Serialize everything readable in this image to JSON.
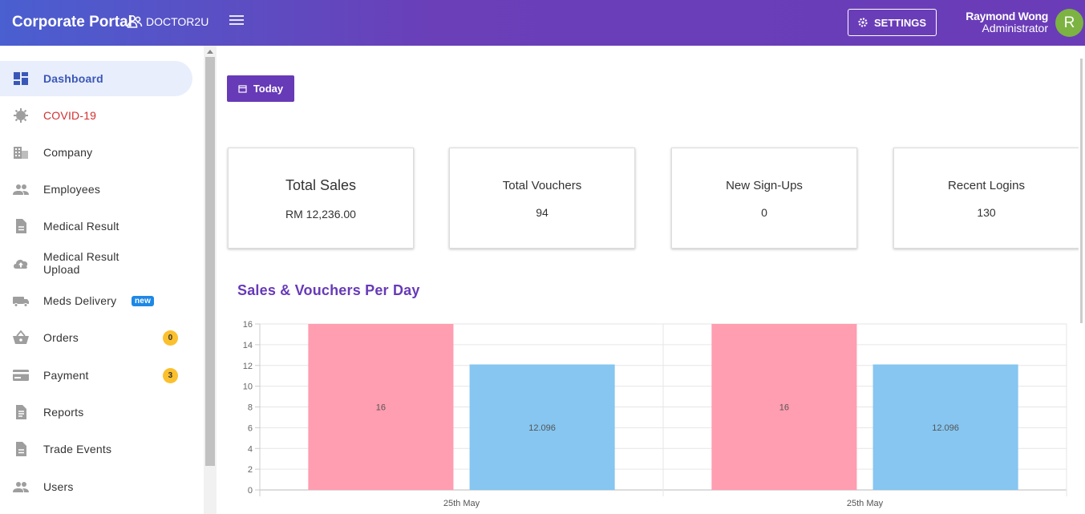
{
  "header": {
    "brand": "Corporate Portal",
    "org": "DOCTOR2U",
    "settings_label": "SETTINGS",
    "user_name": "Raymond Wong",
    "user_role": "Administrator",
    "avatar_initial": "R"
  },
  "sidebar": {
    "items": [
      {
        "label": "Dashboard",
        "icon": "dashboard-icon"
      },
      {
        "label": "COVID-19",
        "icon": "virus-icon"
      },
      {
        "label": "Company",
        "icon": "building-icon"
      },
      {
        "label": "Employees",
        "icon": "people-icon"
      },
      {
        "label": "Medical Result",
        "icon": "document-icon"
      },
      {
        "label": "Medical Result Upload",
        "icon": "cloud-upload-icon"
      },
      {
        "label": "Meds Delivery",
        "icon": "truck-icon",
        "tag": "new"
      },
      {
        "label": "Orders",
        "icon": "basket-icon",
        "badge": "0"
      },
      {
        "label": "Payment",
        "icon": "credit-card-icon",
        "badge": "3"
      },
      {
        "label": "Reports",
        "icon": "report-icon"
      },
      {
        "label": "Trade Events",
        "icon": "document-icon"
      },
      {
        "label": "Users",
        "icon": "people-icon"
      }
    ]
  },
  "main": {
    "today_label": "Today",
    "cards": [
      {
        "title": "Total Sales",
        "value": "RM 12,236.00"
      },
      {
        "title": "Total Vouchers",
        "value": "94"
      },
      {
        "title": "New Sign-Ups",
        "value": "0"
      },
      {
        "title": "Recent Logins",
        "value": "130"
      }
    ],
    "chart_title": "Sales & Vouchers Per Day"
  },
  "colors": {
    "accent": "#673ab7",
    "sales_bar": "#ff9db1",
    "vouchers_bar": "#86c6f0"
  },
  "chart_data": {
    "type": "bar",
    "categories": [
      "25th May",
      "25th May"
    ],
    "series": [
      {
        "values": [
          16,
          16
        ],
        "labels": [
          "16",
          "16"
        ]
      },
      {
        "values": [
          12.096,
          12.096
        ],
        "labels": [
          "12.096",
          "12.096"
        ]
      }
    ],
    "ylim": [
      0,
      16
    ],
    "yticks": [
      0,
      2,
      4,
      6,
      8,
      10,
      12,
      14,
      16
    ],
    "grid": true
  }
}
